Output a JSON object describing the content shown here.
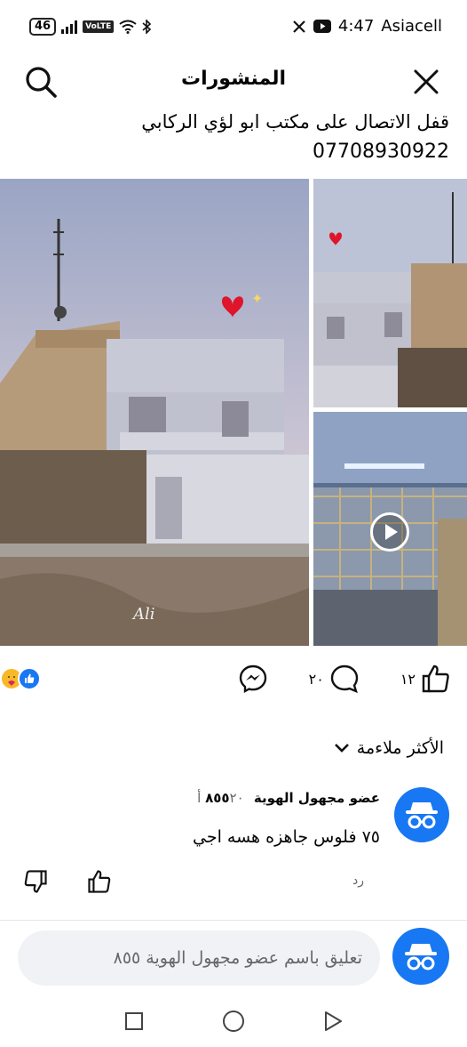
{
  "status_bar": {
    "network_badge": "46",
    "volte": "VoLTE",
    "time": "4:47",
    "carrier": "Asiacell"
  },
  "header": {
    "title": "المنشورات",
    "close_icon": "close-icon",
    "search_icon": "search-icon"
  },
  "post": {
    "text": "قفل الاتصال على مكتب ابو لؤي الركابي",
    "phone": "07708930922",
    "photo_signature": "Ali"
  },
  "reactions": {
    "icons": [
      "like-icon",
      "care-icon"
    ],
    "like_count": "١٢",
    "comment_count": "٢٠"
  },
  "comments_sort": {
    "label": "الأكثر ملاءمة"
  },
  "comment": {
    "author": "عضو مجهول الهوية ٨٥٥",
    "meta": "٢٠ أ",
    "body": "٧٥ فلوس جاهزه هسه اجي",
    "reply_label": "رد"
  },
  "composer": {
    "placeholder": "تعليق باسم عضو مجهول الهوية ٨٥٥"
  },
  "colors": {
    "brand_blue": "#1877f2",
    "secondary_text": "#65676b",
    "input_bg": "#f0f2f5"
  }
}
